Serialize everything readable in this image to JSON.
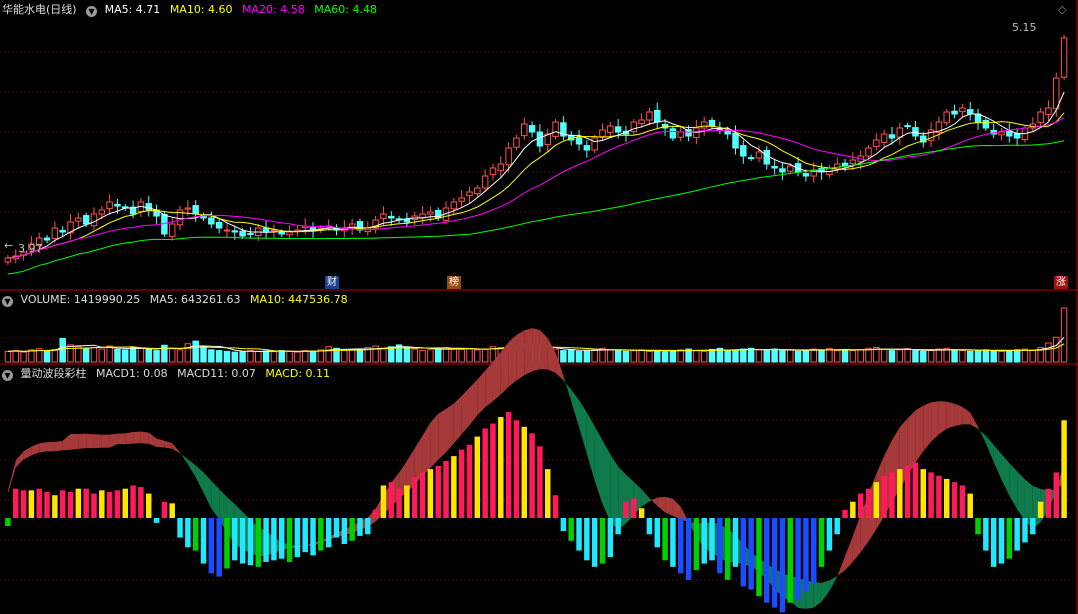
{
  "colors": {
    "up": "#ff5050",
    "down": "#54ffff",
    "ma5": "#ffffff",
    "ma10": "#ffff00",
    "ma20": "#ff00ff",
    "ma60": "#00ff00",
    "grid": "#800000",
    "band_red": "#a63a3a",
    "band_green": "#0f7a4a",
    "macd_red": "#ff1a5a",
    "macd_yellow": "#ffe600",
    "macd_green": "#00d000",
    "macd_blue": "#1a4dff",
    "macd_cyan": "#20e8ff"
  },
  "header_main": {
    "title": "华能水电(日线)",
    "ma5": "MA5: 4.71",
    "ma10": "MA10: 4.60",
    "ma20": "MA20: 4.58",
    "ma60": "MA60: 4.48"
  },
  "header_volume": {
    "volume": "VOLUME: 1419990.25",
    "ma5": "MA5: 643261.63",
    "ma10": "MA10: 447536.78"
  },
  "header_macd": {
    "name": "量动波段彩柱",
    "macd1": "MACD1: 0.08",
    "macd11": "MACD11: 0.07",
    "macd": "MACD: 0.11"
  },
  "price_labels": {
    "high": "5.15",
    "low": "3.97"
  },
  "event_tags": {
    "t1": "财",
    "t2": "榜",
    "t3": "涨"
  },
  "chart_data": [
    {
      "type": "candlestick",
      "title": "华能水电(日线)",
      "series": [
        {
          "name": "MA5",
          "last": 4.71
        },
        {
          "name": "MA10",
          "last": 4.6
        },
        {
          "name": "MA20",
          "last": 4.58
        },
        {
          "name": "MA60",
          "last": 4.48
        }
      ],
      "close": [
        4.05,
        4.06,
        4.08,
        4.12,
        4.15,
        4.14,
        4.2,
        4.18,
        4.23,
        4.25,
        4.22,
        4.27,
        4.29,
        4.33,
        4.31,
        4.3,
        4.27,
        4.33,
        4.29,
        4.26,
        4.17,
        4.22,
        4.29,
        4.3,
        4.27,
        4.25,
        4.22,
        4.2,
        4.19,
        4.18,
        4.16,
        4.17,
        4.2,
        4.18,
        4.19,
        4.17,
        4.18,
        4.19,
        4.21,
        4.19,
        4.2,
        4.21,
        4.19,
        4.2,
        4.22,
        4.19,
        4.2,
        4.24,
        4.27,
        4.25,
        4.24,
        4.23,
        4.26,
        4.27,
        4.28,
        4.25,
        4.3,
        4.33,
        4.35,
        4.38,
        4.4,
        4.46,
        4.5,
        4.52,
        4.6,
        4.65,
        4.72,
        4.68,
        4.61,
        4.67,
        4.73,
        4.66,
        4.64,
        4.62,
        4.59,
        4.65,
        4.69,
        4.71,
        4.68,
        4.67,
        4.73,
        4.74,
        4.78,
        4.73,
        4.7,
        4.65,
        4.68,
        4.66,
        4.7,
        4.73,
        4.71,
        4.69,
        4.67,
        4.6,
        4.56,
        4.55,
        4.58,
        4.52,
        4.5,
        4.48,
        4.51,
        4.48,
        4.46,
        4.49,
        4.48,
        4.5,
        4.52,
        4.51,
        4.54,
        4.56,
        4.6,
        4.64,
        4.67,
        4.65,
        4.7,
        4.71,
        4.66,
        4.63,
        4.69,
        4.73,
        4.78,
        4.77,
        4.8,
        4.77,
        4.73,
        4.7,
        4.67,
        4.68,
        4.66,
        4.65,
        4.7,
        4.72,
        4.78,
        4.8,
        4.95,
        5.15
      ],
      "ylim": [
        3.9,
        5.25
      ]
    },
    {
      "type": "bar",
      "title": "VOLUME",
      "last": 1419990.25,
      "ma5_last": 643261.63,
      "ma10_last": 447536.78,
      "values": [
        0.28,
        0.3,
        0.26,
        0.32,
        0.35,
        0.3,
        0.33,
        0.62,
        0.45,
        0.4,
        0.36,
        0.38,
        0.34,
        0.42,
        0.33,
        0.32,
        0.38,
        0.36,
        0.35,
        0.3,
        0.44,
        0.35,
        0.32,
        0.48,
        0.55,
        0.4,
        0.32,
        0.3,
        0.28,
        0.26,
        0.27,
        0.3,
        0.28,
        0.29,
        0.27,
        0.3,
        0.28,
        0.26,
        0.3,
        0.28,
        0.32,
        0.4,
        0.36,
        0.3,
        0.32,
        0.34,
        0.38,
        0.42,
        0.35,
        0.4,
        0.45,
        0.38,
        0.34,
        0.3,
        0.32,
        0.36,
        0.38,
        0.34,
        0.33,
        0.35,
        0.32,
        0.34,
        0.4,
        0.38,
        0.42,
        0.45,
        0.48,
        0.4,
        0.36,
        0.32,
        0.34,
        0.3,
        0.32,
        0.28,
        0.3,
        0.32,
        0.36,
        0.33,
        0.3,
        0.28,
        0.3,
        0.32,
        0.28,
        0.3,
        0.27,
        0.3,
        0.32,
        0.34,
        0.3,
        0.28,
        0.33,
        0.36,
        0.3,
        0.32,
        0.34,
        0.36,
        0.32,
        0.3,
        0.34,
        0.3,
        0.32,
        0.28,
        0.3,
        0.34,
        0.32,
        0.36,
        0.3,
        0.33,
        0.3,
        0.32,
        0.36,
        0.38,
        0.34,
        0.3,
        0.32,
        0.35,
        0.3,
        0.28,
        0.3,
        0.34,
        0.36,
        0.32,
        0.3,
        0.28,
        0.3,
        0.32,
        0.3,
        0.28,
        0.3,
        0.32,
        0.34,
        0.3,
        0.38,
        0.5,
        0.65,
        1.42
      ],
      "unit": "x1e6"
    },
    {
      "type": "bar",
      "title": "量动波段彩柱",
      "macd1_last": 0.08,
      "macd11_last": 0.07,
      "macd_last": 0.11,
      "values": [
        -0.05,
        0.18,
        0.17,
        0.17,
        0.18,
        0.16,
        0.14,
        0.17,
        0.16,
        0.18,
        0.18,
        0.15,
        0.17,
        0.16,
        0.17,
        0.18,
        0.2,
        0.19,
        0.15,
        -0.03,
        0.1,
        0.09,
        -0.12,
        -0.18,
        -0.2,
        -0.28,
        -0.34,
        -0.36,
        -0.31,
        -0.26,
        -0.28,
        -0.29,
        -0.3,
        -0.27,
        -0.26,
        -0.25,
        -0.27,
        -0.24,
        -0.21,
        -0.23,
        -0.2,
        -0.18,
        -0.12,
        -0.16,
        -0.14,
        -0.11,
        -0.1,
        0.05,
        0.2,
        0.22,
        0.18,
        0.2,
        0.25,
        0.28,
        0.3,
        0.32,
        0.35,
        0.38,
        0.42,
        0.45,
        0.5,
        0.55,
        0.58,
        0.62,
        0.65,
        0.6,
        0.56,
        0.52,
        0.44,
        0.3,
        0.14,
        -0.08,
        -0.14,
        -0.2,
        -0.26,
        -0.3,
        -0.28,
        -0.24,
        -0.1,
        0.1,
        0.12,
        0.06,
        -0.1,
        -0.18,
        -0.26,
        -0.3,
        -0.34,
        -0.38,
        -0.32,
        -0.28,
        -0.26,
        -0.34,
        -0.38,
        -0.3,
        -0.42,
        -0.44,
        -0.48,
        -0.52,
        -0.55,
        -0.58,
        -0.52,
        -0.5,
        -0.45,
        -0.4,
        -0.3,
        -0.2,
        -0.1,
        0.05,
        0.1,
        0.15,
        0.18,
        0.22,
        0.26,
        0.28,
        0.3,
        0.32,
        0.34,
        0.3,
        0.28,
        0.26,
        0.24,
        0.22,
        0.2,
        0.15,
        -0.1,
        -0.2,
        -0.3,
        -0.28,
        -0.25,
        -0.2,
        -0.15,
        -0.1,
        0.1,
        0.18,
        0.28,
        0.6
      ]
    }
  ]
}
